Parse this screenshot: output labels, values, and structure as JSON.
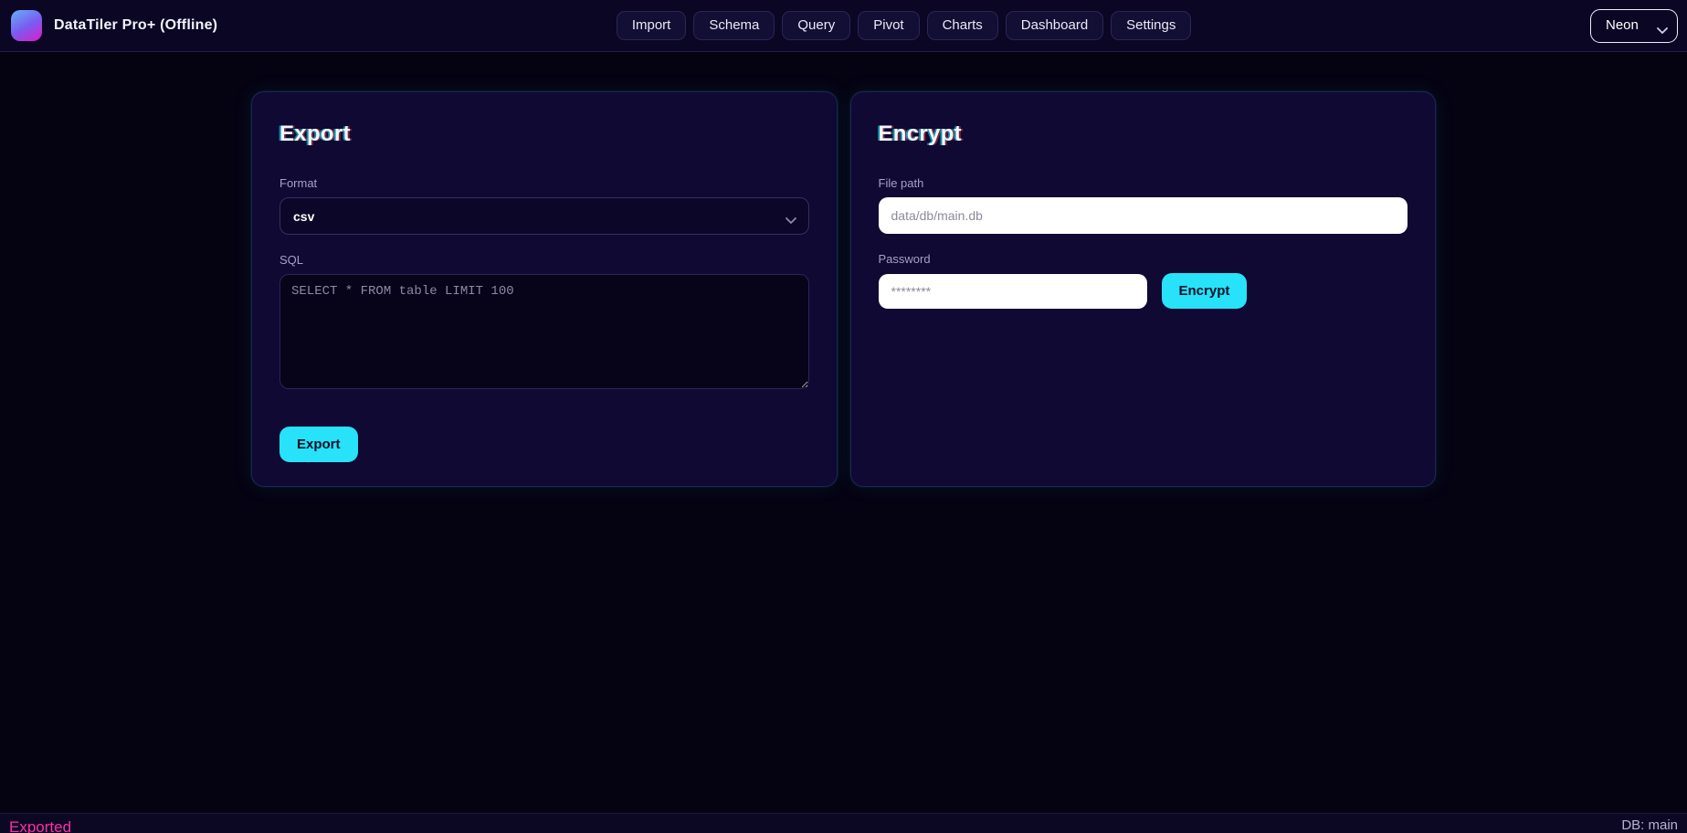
{
  "app": {
    "title": "DataTiler Pro+ (Offline)"
  },
  "nav": {
    "items": [
      "Import",
      "Schema",
      "Query",
      "Pivot",
      "Charts",
      "Dashboard",
      "Settings"
    ]
  },
  "theme": {
    "selected": "Neon"
  },
  "export_card": {
    "title": "Export",
    "format": {
      "label": "Format",
      "value": "csv"
    },
    "sql": {
      "label": "SQL",
      "placeholder": "SELECT * FROM table LIMIT 100"
    },
    "button": "Export"
  },
  "encrypt_card": {
    "title": "Encrypt",
    "file_path": {
      "label": "File path",
      "placeholder": "data/db/main.db"
    },
    "password": {
      "label": "Password",
      "placeholder": "********"
    },
    "button": "Encrypt"
  },
  "status_bar": {
    "message": "Exported",
    "db": "DB: main"
  },
  "icons": {
    "theme_select": "chevron-down",
    "format_select": "chevron-down"
  },
  "colors": {
    "accent": "#27e2f8",
    "status_message": "#ff2da8",
    "page_bg": "#050212",
    "card_bg": "#0f0933",
    "logo_gradient_start": "#63b2f7",
    "logo_gradient_end": "#e01bc8"
  }
}
